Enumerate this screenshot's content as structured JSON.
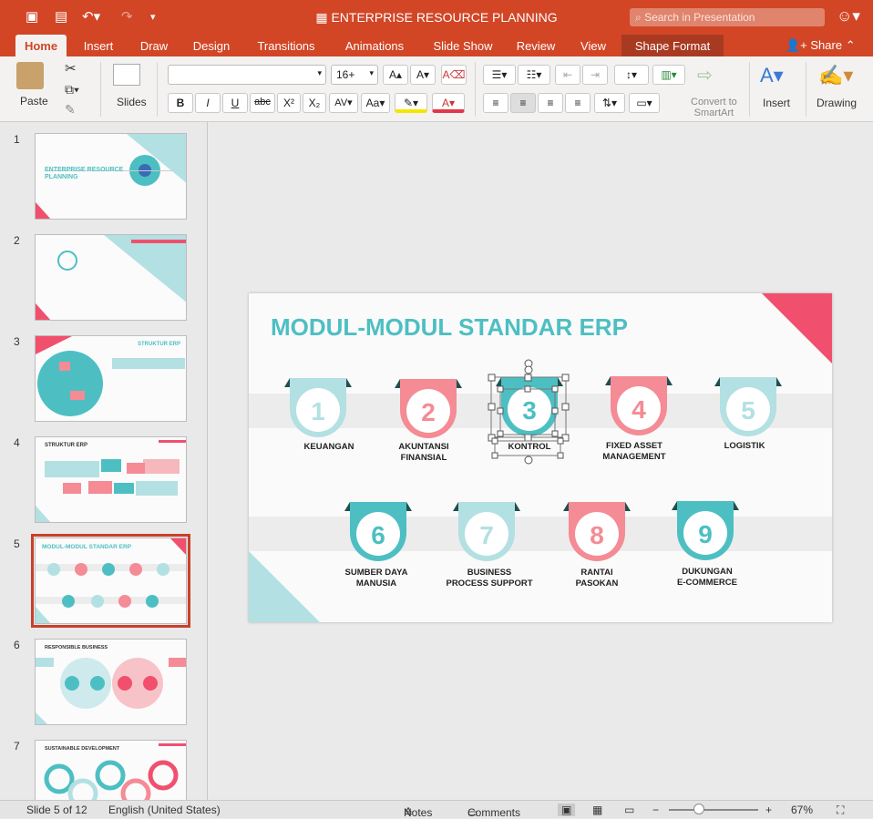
{
  "window": {
    "title": "ENTERPRISE RESOURCE PLANNING"
  },
  "search": {
    "placeholder": "Search in Presentation"
  },
  "tabs": [
    "Home",
    "Insert",
    "Draw",
    "Design",
    "Transitions",
    "Animations",
    "Slide Show",
    "Review",
    "View",
    "Shape Format"
  ],
  "share_label": "Share",
  "ribbon": {
    "paste": "Paste",
    "slides": "Slides",
    "font_name": "",
    "font_size": "16+",
    "convert_smartart_line1": "Convert to",
    "convert_smartart_line2": "SmartArt",
    "insert": "Insert",
    "drawing": "Drawing"
  },
  "thumbnails": [
    {
      "num": "1",
      "title": "ENTERPRISE RESOURCE PLANNING"
    },
    {
      "num": "2",
      "title": ""
    },
    {
      "num": "3",
      "title": "STRUKTUR ERP"
    },
    {
      "num": "4",
      "title": "STRUKTUR ERP"
    },
    {
      "num": "5",
      "title": "MODUL-MODUL STANDAR ERP"
    },
    {
      "num": "6",
      "title": "RESPONSIBLE BUSINESS"
    },
    {
      "num": "7",
      "title": "SUSTAINABLE DEVELOPMENT"
    }
  ],
  "slide": {
    "title": "MODUL-MODUL STANDAR ERP",
    "modules": [
      {
        "num": "1",
        "line1": "KEUANGAN",
        "line2": "",
        "color": "#b3e0e2"
      },
      {
        "num": "2",
        "line1": "AKUNTANSI",
        "line2": "FINANSIAL",
        "color": "#f48b95"
      },
      {
        "num": "3",
        "line1": "KONTROL",
        "line2": "",
        "color": "#4dbfc3"
      },
      {
        "num": "4",
        "line1": "FIXED ASSET",
        "line2": "MANAGEMENT",
        "color": "#f48b95"
      },
      {
        "num": "5",
        "line1": "LOGISTIK",
        "line2": "",
        "color": "#b3e0e2"
      },
      {
        "num": "6",
        "line1": "SUMBER DAYA",
        "line2": "MANUSIA",
        "color": "#4dbfc3"
      },
      {
        "num": "7",
        "line1": "BUSINESS",
        "line2": "PROCESS SUPPORT",
        "color": "#b3e0e2"
      },
      {
        "num": "8",
        "line1": "RANTAI",
        "line2": "PASOKAN",
        "color": "#f48b95"
      },
      {
        "num": "9",
        "line1": "DUKUNGAN",
        "line2": "E-COMMERCE",
        "color": "#4dbfc3"
      }
    ]
  },
  "status": {
    "slide_info": "Slide 5 of 12",
    "language": "English (United States)",
    "notes": "Notes",
    "comments": "Comments",
    "zoom": "67%"
  },
  "colors": {
    "accent": "#d24626",
    "teal": "#4dbfc3",
    "pink": "#f0506e"
  }
}
